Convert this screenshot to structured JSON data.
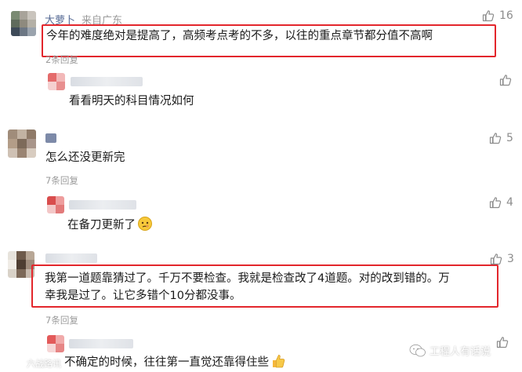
{
  "comments": [
    {
      "author": "大萝卜",
      "region": "来自广东",
      "text": "今年的难度绝对是提高了，高频考点考的不多，以往的重点章节都分值不高啊",
      "reply_count": "2条回复",
      "likes": "16"
    },
    {
      "text": "看看明天的科目情况如何",
      "likes": ""
    },
    {
      "text": "怎么还没更新完",
      "reply_count": "7条回复",
      "likes": "5"
    },
    {
      "text": "在备刀更新了",
      "likes": "4"
    },
    {
      "line1": "我第一道题靠猜过了。千万不要检查。我就是检查改了4道题。对的改到错的。万",
      "line2": "幸我是过了。让它多错个10分都没事。",
      "reply_count": "7条回复",
      "likes": "3"
    },
    {
      "text": "不确定的时候，往往第一直觉还靠得住些",
      "likes": ""
    }
  ],
  "watermark": {
    "left": "六战路讯",
    "right": "工程人有话说"
  },
  "icons": {
    "like": "thumbs-up-icon",
    "wechat": "wechat-icon",
    "emoji_thinking": "thinking-emoji-icon",
    "emoji_thumb": "thumbs-up-emoji-icon"
  },
  "colors": {
    "highlight": "#e3262c",
    "name": "#576b95",
    "meta": "#9a9a9a"
  }
}
